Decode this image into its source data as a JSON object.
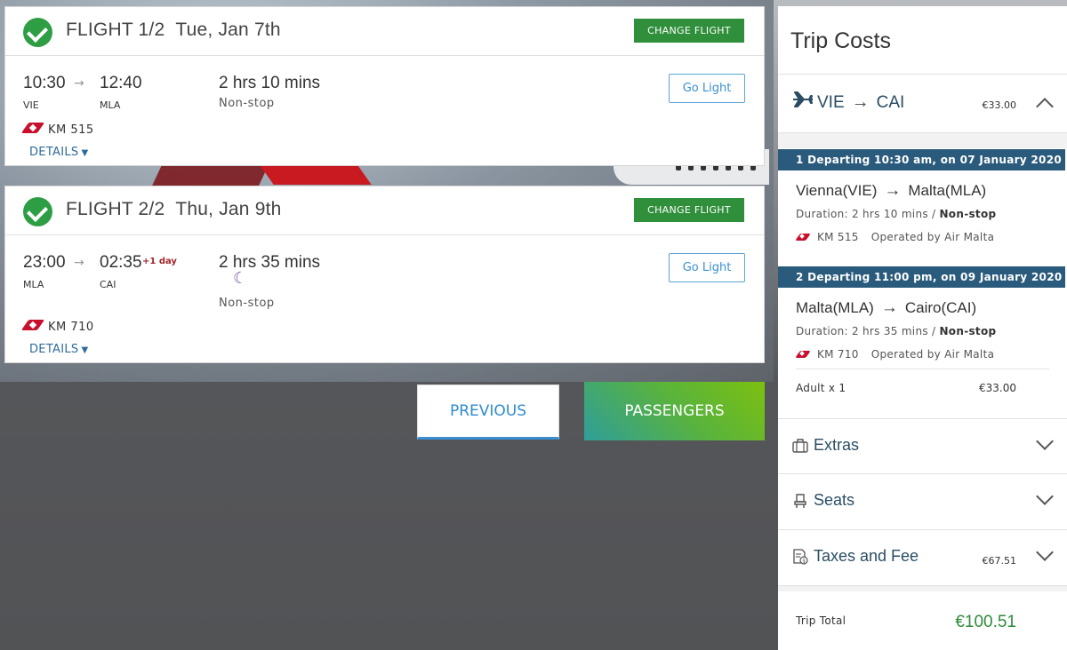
{
  "flights": [
    {
      "title": "FLIGHT 1/2",
      "date": "Tue, Jan 7th",
      "change_label": "CHANGE FLIGHT",
      "depart_time": "10:30",
      "arrive_time": "12:40",
      "depart_code": "VIE",
      "arrive_code": "MLA",
      "plus_day": "",
      "duration": "2 hrs 10 mins",
      "stops": "Non-stop",
      "fare_label": "Go Light",
      "flight_no": "KM 515",
      "details_label": "DETAILS"
    },
    {
      "title": "FLIGHT 2/2",
      "date": "Thu, Jan 9th",
      "change_label": "CHANGE FLIGHT",
      "depart_time": "23:00",
      "arrive_time": "02:35",
      "depart_code": "MLA",
      "arrive_code": "CAI",
      "plus_day": "+1 day",
      "duration": "2 hrs 35 mins",
      "stops": "Non-stop",
      "fare_label": "Go Light",
      "flight_no": "KM 710",
      "details_label": "DETAILS"
    }
  ],
  "nav": {
    "previous_label": "PREVIOUS",
    "passengers_label": "PASSENGERS"
  },
  "trip_costs": {
    "title": "Trip Costs",
    "route_from": "VIE",
    "route_to": "CAI",
    "route_price": "€33.00",
    "legs": [
      {
        "header": "1 Departing  10:30 am, on 07 January 2020",
        "from": "Vienna(VIE)",
        "to": "Malta(MLA)",
        "duration": "Duration: 2 hrs 10 mins / ",
        "stops": "Non-stop",
        "flight_no": "KM 515",
        "operator": "Operated by Air Malta"
      },
      {
        "header": "2 Departing  11:00 pm, on 09 January 2020",
        "from": "Malta(MLA)",
        "to": "Cairo(CAI)",
        "duration": "Duration: 2 hrs 35 mins / ",
        "stops": "Non-stop",
        "flight_no": "KM 710",
        "operator": "Operated by Air Malta"
      }
    ],
    "passenger_label": "Adult x 1",
    "passenger_price": "€33.00",
    "extras_label": "Extras",
    "seats_label": "Seats",
    "taxes_label": "Taxes and Fee",
    "taxes_price": "€67.51",
    "total_label": "Trip Total",
    "total_value": "€100.51"
  },
  "colors": {
    "accent_green": "#2f8f3a",
    "link_blue": "#3a8fd0",
    "header_bar": "#2a5a7c",
    "brand_red": "#c8102e"
  }
}
